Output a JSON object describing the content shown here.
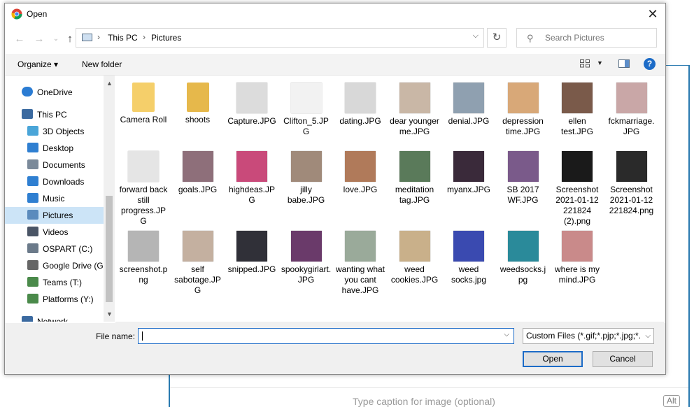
{
  "window": {
    "title": "Open",
    "close_label": "✕"
  },
  "address": {
    "crumbs": [
      "This PC",
      "Pictures"
    ],
    "separator": "›"
  },
  "search": {
    "placeholder": "Search Pictures"
  },
  "toolbar": {
    "organize": "Organize ▾",
    "new_folder": "New folder",
    "help": "?"
  },
  "nav": [
    {
      "label": "OneDrive",
      "icon": "cloud-icon",
      "color": "#2b7cd3"
    },
    {
      "label": "This PC",
      "icon": "computer-icon",
      "color": "#3b6aa0"
    },
    {
      "label": "3D Objects",
      "icon": "cube-icon",
      "color": "#4aa5d8"
    },
    {
      "label": "Desktop",
      "icon": "desktop-icon",
      "color": "#2f7fd1"
    },
    {
      "label": "Documents",
      "icon": "document-icon",
      "color": "#7b8a9a"
    },
    {
      "label": "Downloads",
      "icon": "download-icon",
      "color": "#2f7fd1"
    },
    {
      "label": "Music",
      "icon": "music-icon",
      "color": "#2f7fd1"
    },
    {
      "label": "Pictures",
      "icon": "pictures-icon",
      "color": "#5b8bbd",
      "selected": true
    },
    {
      "label": "Videos",
      "icon": "video-icon",
      "color": "#4a5566"
    },
    {
      "label": "OSPART (C:)",
      "icon": "windows-drive-icon",
      "color": "#6b7a8a"
    },
    {
      "label": "Google Drive (G:",
      "icon": "drive-icon",
      "color": "#666666"
    },
    {
      "label": "Teams (T:)",
      "icon": "network-drive-icon",
      "color": "#4a8a4a"
    },
    {
      "label": "Platforms (Y:)",
      "icon": "network-drive-icon",
      "color": "#4a8a4a"
    },
    {
      "label": "Network",
      "icon": "network-icon",
      "color": "#3b6aa0"
    }
  ],
  "files": [
    {
      "name": "Camera Roll",
      "kind": "folder",
      "color": "#f5cf6a"
    },
    {
      "name": "shoots",
      "kind": "folder",
      "color": "#e6b84b"
    },
    {
      "name": "Capture.JPG",
      "kind": "image",
      "color": "#dcdcdc"
    },
    {
      "name": "Clifton_5.JPG",
      "kind": "image",
      "color": "#f2f2f2"
    },
    {
      "name": "dating.JPG",
      "kind": "image",
      "color": "#d8d8d8"
    },
    {
      "name": "dear younger me.JPG",
      "kind": "image",
      "color": "#c9b7a6"
    },
    {
      "name": "denial.JPG",
      "kind": "image",
      "color": "#8fa0b0"
    },
    {
      "name": "depression time.JPG",
      "kind": "image",
      "color": "#d8a878"
    },
    {
      "name": "ellen test.JPG",
      "kind": "image",
      "color": "#7a5a4a"
    },
    {
      "name": "fckmarriage.JPG",
      "kind": "image",
      "color": "#c9a7a7"
    },
    {
      "name": "forward back still progress.JPG",
      "kind": "image",
      "color": "#e5e5e5"
    },
    {
      "name": "goals.JPG",
      "kind": "image",
      "color": "#8e6f7a"
    },
    {
      "name": "highdeas.JPG",
      "kind": "image",
      "color": "#c94a7a"
    },
    {
      "name": "jilly babe.JPG",
      "kind": "image",
      "color": "#a08a7a"
    },
    {
      "name": "love.JPG",
      "kind": "image",
      "color": "#b07a5a"
    },
    {
      "name": "meditation tag.JPG",
      "kind": "image",
      "color": "#5a7a5a"
    },
    {
      "name": "myanx.JPG",
      "kind": "image",
      "color": "#3a2a3a"
    },
    {
      "name": "SB 2017 WF.JPG",
      "kind": "image",
      "color": "#7a5a8a"
    },
    {
      "name": "Screenshot 2021-01-12 221824 (2).png",
      "kind": "image",
      "color": "#1a1a1a"
    },
    {
      "name": "Screenshot 2021-01-12 221824.png",
      "kind": "image",
      "color": "#2a2a2a"
    },
    {
      "name": "screenshot.png",
      "kind": "image",
      "color": "#b5b5b5"
    },
    {
      "name": "self sabotage.JPG",
      "kind": "image",
      "color": "#c4b0a0"
    },
    {
      "name": "snipped.JPG",
      "kind": "image",
      "color": "#303038"
    },
    {
      "name": "spookygirlart.JPG",
      "kind": "image",
      "color": "#6a3a6a"
    },
    {
      "name": "wanting what you cant have.JPG",
      "kind": "image",
      "color": "#9aaa9a"
    },
    {
      "name": "weed cookies.JPG",
      "kind": "image",
      "color": "#c9b08a"
    },
    {
      "name": "weed socks.jpg",
      "kind": "image",
      "color": "#3a4ab0"
    },
    {
      "name": "weedsocks.jpg",
      "kind": "image",
      "color": "#2a8a9a"
    },
    {
      "name": "where is my mind.JPG",
      "kind": "image",
      "color": "#c98a8a"
    }
  ],
  "bottom": {
    "file_name_label": "File name:",
    "file_name_value": "",
    "filter": "Custom Files (*.gif;*.pjp;*.jpg;*.",
    "open": "Open",
    "cancel": "Cancel"
  },
  "background": {
    "caption_placeholder": "Type caption for image (optional)",
    "alt_label": "Alt"
  }
}
